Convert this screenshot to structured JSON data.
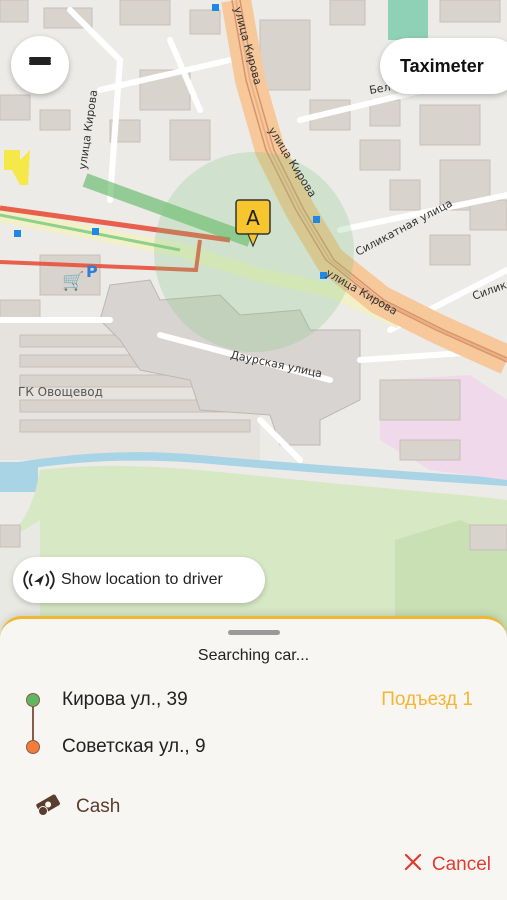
{
  "map": {
    "streets": {
      "kirova_vertical": "улица Кирова",
      "kirova_diag": "улица Кирова",
      "kirova_lower": "улица Кирова",
      "kirova_left": "улица Кирова",
      "silikatnaya": "Силикатная улица",
      "silikatnaya_short": "Силик",
      "daurskaya": "Даурская улица",
      "bel": "Бел"
    },
    "poi_label": "ГК Овощевод",
    "marker_label": "A",
    "parking_label": "P"
  },
  "header": {
    "menu_icon": "hamburger-icon",
    "taximeter_label": "Taximeter"
  },
  "show_location": {
    "icon": "location-broadcast-icon",
    "label": "Show location to driver"
  },
  "sheet": {
    "status": "Searching car...",
    "pickup": "Кирова ул., 39",
    "dropoff": "Советская ул., 9",
    "entrance": "Подъезд 1",
    "payment_icon": "cash-icon",
    "payment": "Cash",
    "cancel_icon": "close-icon",
    "cancel_label": "Cancel"
  },
  "colors": {
    "accent": "#f2b632",
    "pickup_dot": "#5fb85f",
    "dropoff_dot": "#f27c3a",
    "cancel": "#e23b32",
    "route": "#e8503a"
  }
}
